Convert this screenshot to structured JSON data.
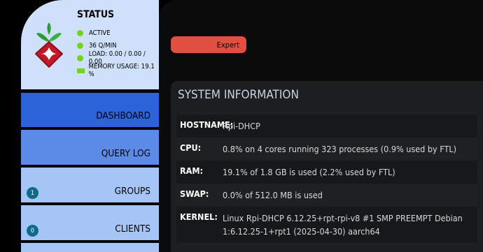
{
  "status": {
    "title": "STATUS",
    "active": "ACTIVE",
    "qpm": "36 Q/MIN",
    "load": "LOAD:  0.00 / 0.00 / 0.00",
    "memory": "MEMORY USAGE:  19.1 %",
    "status_color": "#72d51c"
  },
  "nav": {
    "dashboard": "DASHBOARD",
    "query_log": "QUERY LOG",
    "groups": "GROUPS",
    "groups_count": "1",
    "clients": "CLIENTS",
    "clients_count": "0"
  },
  "main": {
    "expert_label": "Expert",
    "card_title": "SYSTEM INFORMATION",
    "rows": [
      {
        "key": "HOSTNAME:",
        "value": "Rpi-DHCP"
      },
      {
        "key": "CPU:",
        "value": "0.8% on 4 cores running 323 processes (0.9% used by FTL)"
      },
      {
        "key": "RAM:",
        "value": "19.1% of 1.8 GB is used (2.2% used by FTL)"
      },
      {
        "key": "SWAP:",
        "value": "0.0% of 512.0 MB is used"
      },
      {
        "key": "KERNEL:",
        "value": "Linux Rpi-DHCP 6.12.25+rpt-rpi-v8 #1 SMP PREEMPT Debian 1:6.12.25-1+rpt1 (2025-04-30) aarch64"
      }
    ]
  },
  "colors": {
    "accent_blue": "#2d63d8",
    "expert_red": "#e04f3f",
    "sidebar_light": "#cfe0fb"
  }
}
